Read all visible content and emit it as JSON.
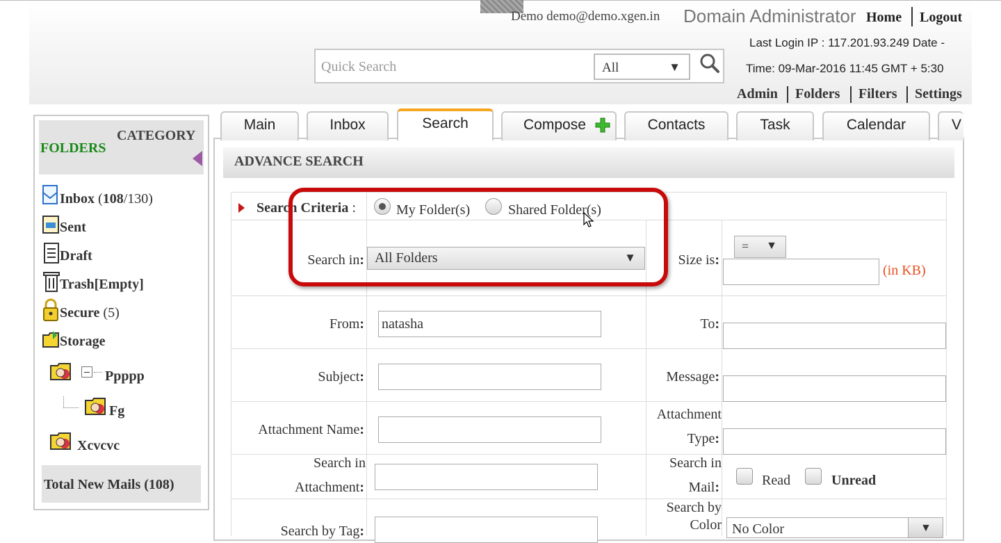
{
  "header": {
    "user": "Demo demo@demo.xgen.in",
    "role": "Domain Administrator",
    "home_link": "Home",
    "logout_link": "Logout",
    "last_login": "Last Login IP : 117.201.93.249 Date -",
    "login_time": "Time: 09-Mar-2016 11:45 GMT + 5:30",
    "quick_search_placeholder": "Quick Search",
    "quick_search_scope": "All",
    "nav": [
      "Admin",
      "Folders",
      "Filters",
      "Settings"
    ]
  },
  "sidebar": {
    "folders_label": "FOLDERS",
    "category_label": "CATEGORY",
    "items": [
      {
        "name": "Inbox",
        "count_text": "(108/130)",
        "unread": "108",
        "total": "/130)"
      },
      {
        "name": "Sent"
      },
      {
        "name": "Draft"
      },
      {
        "name": "Trash[Empty]"
      },
      {
        "name": "Secure",
        "count_text": "(5)"
      },
      {
        "name": "Storage"
      },
      {
        "name": "Ppppp"
      },
      {
        "name": "Fg"
      },
      {
        "name": "Xcvcvc"
      }
    ],
    "total_new": "Total New Mails (108)"
  },
  "tabs": [
    "Main",
    "Inbox",
    "Search",
    "Compose",
    "Contacts",
    "Task",
    "Calendar",
    "V"
  ],
  "active_tab": "Search",
  "advance_search": {
    "title": "ADVANCE SEARCH",
    "criteria_label": "Search Criteria",
    "criteria_colon": ":",
    "radio_my": "My Folder(s)",
    "radio_shared": "Shared Folder(s)",
    "search_in_label": "Search in",
    "search_in_value": "All Folders",
    "size_label": "Size is",
    "size_operator": "=",
    "size_unit": "(in KB)",
    "from_label": "From",
    "from_value": "natasha",
    "to_label": "To",
    "subject_label": "Subject",
    "message_label": "Message",
    "attachment_name_label": "Attachment Name",
    "attachment_type_label_1": "Attachment",
    "attachment_type_label_2": "Type",
    "search_in_attachment_1": "Search in",
    "search_in_attachment_2": "Attachment",
    "search_in_mail_1": "Search in",
    "search_in_mail_2": "Mail",
    "read_label": "Read",
    "unread_label": "Unread",
    "search_by_tag": "Search by Tag",
    "search_by_color_1": "Search by",
    "search_by_color_2": "Color",
    "color_value": "No Color"
  },
  "colors": {
    "accent_tab": "#f5a623",
    "highlight": "#c80a0a",
    "folders_green": "#1a8a1a",
    "unit_orange": "#e8501e"
  }
}
